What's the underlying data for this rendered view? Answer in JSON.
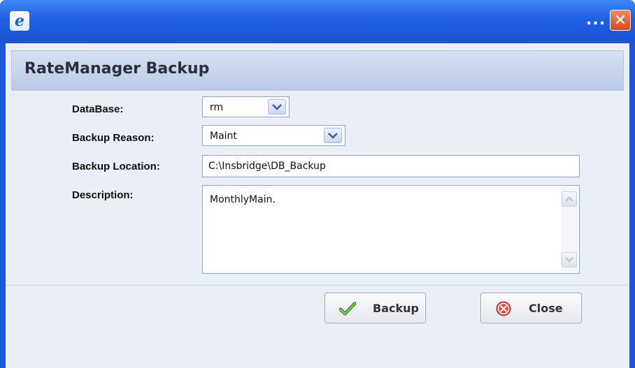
{
  "window": {
    "title_icon": "internet-explorer-icon",
    "ellipsis": "...",
    "close_glyph": "✕"
  },
  "dialog": {
    "title": "RateManager Backup"
  },
  "form": {
    "database": {
      "label": "DataBase:",
      "value": "rm"
    },
    "backup_reason": {
      "label": "Backup Reason:",
      "value": "Maint"
    },
    "backup_location": {
      "label": "Backup Location:",
      "value": "C:\\Insbridge\\DB_Backup"
    },
    "description": {
      "label": "Description:",
      "value": "MonthlyMain."
    }
  },
  "buttons": {
    "backup": {
      "label": "Backup",
      "icon": "checkmark-icon"
    },
    "close": {
      "label": "Close",
      "icon": "red-x-circle-icon"
    }
  },
  "colors": {
    "titlebar": "#1f5fe3",
    "client_bg": "#e9eef7",
    "header_band": "#c9d6ec"
  }
}
